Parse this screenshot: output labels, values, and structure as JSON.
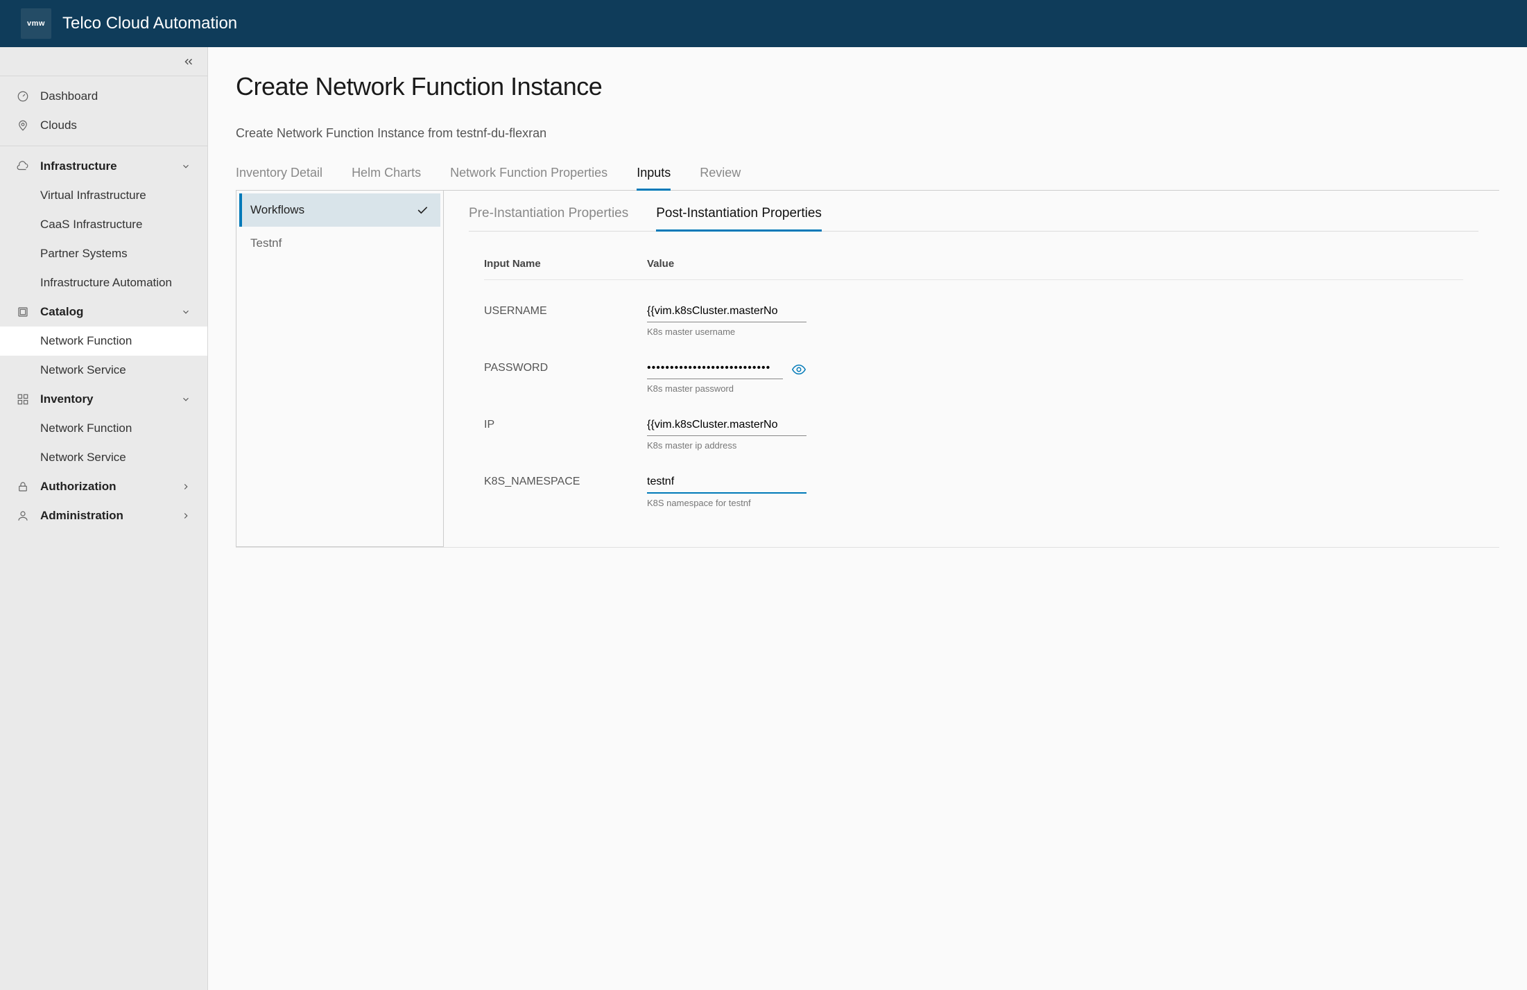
{
  "header": {
    "logo_text": "vmw",
    "product": "Telco Cloud Automation"
  },
  "sidebar": {
    "top": [
      {
        "icon": "gauge",
        "label": "Dashboard"
      },
      {
        "icon": "pin",
        "label": "Clouds"
      }
    ],
    "groups": [
      {
        "icon": "cloud",
        "label": "Infrastructure",
        "expanded": true,
        "items": [
          "Virtual Infrastructure",
          "CaaS Infrastructure",
          "Partner Systems",
          "Infrastructure Automation"
        ]
      },
      {
        "icon": "catalog",
        "label": "Catalog",
        "expanded": true,
        "items": [
          "Network Function",
          "Network Service"
        ],
        "active_index": 0
      },
      {
        "icon": "grid",
        "label": "Inventory",
        "expanded": true,
        "items": [
          "Network Function",
          "Network Service"
        ]
      },
      {
        "icon": "lock",
        "label": "Authorization",
        "expanded": false
      },
      {
        "icon": "user",
        "label": "Administration",
        "expanded": false
      }
    ]
  },
  "page": {
    "title": "Create Network Function Instance",
    "subtitle": "Create Network Function Instance from testnf-du-flexran",
    "tabs": [
      "Inventory Detail",
      "Helm Charts",
      "Network Function Properties",
      "Inputs",
      "Review"
    ],
    "active_tab": 3,
    "workflows": [
      {
        "name": "Workflows",
        "complete": true
      },
      {
        "name": "Testnf",
        "complete": false
      }
    ],
    "active_workflow": 0,
    "subtabs": [
      "Pre-Instantiation Properties",
      "Post-Instantiation Properties"
    ],
    "active_subtab": 1,
    "columns": {
      "name": "Input Name",
      "value": "Value"
    },
    "inputs": [
      {
        "key": "USERNAME",
        "value": "{{vim.k8sCluster.masterNo",
        "hint": "K8s master username",
        "type": "text"
      },
      {
        "key": "PASSWORD",
        "value": "•••••••••••••••••••••••••••",
        "hint": "K8s master password",
        "type": "password"
      },
      {
        "key": "IP",
        "value": "{{vim.k8sCluster.masterNo",
        "hint": "K8s master ip address",
        "type": "text"
      },
      {
        "key": "K8S_NAMESPACE",
        "value": "testnf",
        "hint": "K8S namespace for testnf",
        "type": "text",
        "focused": true
      }
    ]
  }
}
